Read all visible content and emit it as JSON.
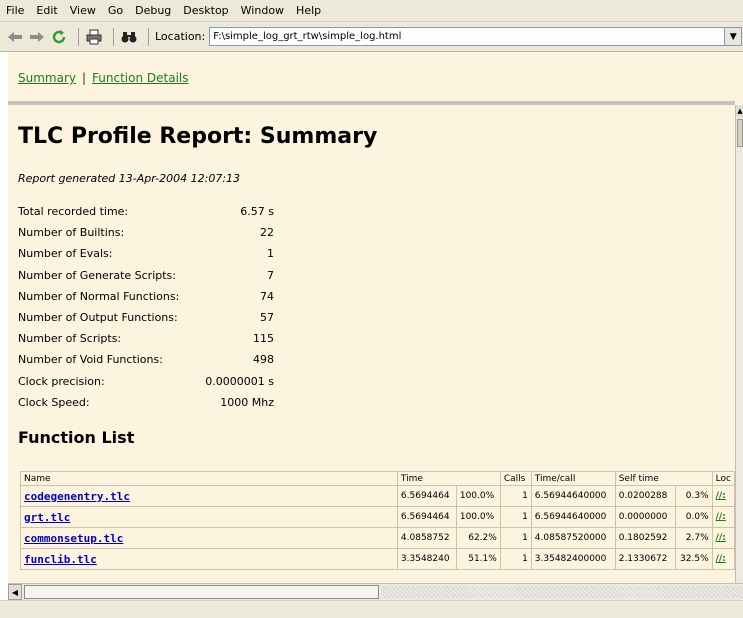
{
  "menu": [
    "File",
    "Edit",
    "View",
    "Go",
    "Debug",
    "Desktop",
    "Window",
    "Help"
  ],
  "toolbar": {
    "location_label": "Location:",
    "location_value": "F:\\simple_log_grt_rtw\\simple_log.html"
  },
  "nav": {
    "summary": "Summary",
    "separator": "|",
    "function_details": "Function Details"
  },
  "report": {
    "title": "TLC Profile Report: Summary",
    "generated": "Report generated 13-Apr-2004 12:07:13"
  },
  "stats": [
    {
      "label": "Total recorded time:",
      "value": "6.57 s"
    },
    {
      "label": "Number of Builtins:",
      "value": "22"
    },
    {
      "label": "Number of Evals:",
      "value": "1"
    },
    {
      "label": "Number of Generate Scripts:",
      "value": "7"
    },
    {
      "label": "Number of Normal Functions:",
      "value": "74"
    },
    {
      "label": "Number of Output Functions:",
      "value": "57"
    },
    {
      "label": "Number of Scripts:",
      "value": "115"
    },
    {
      "label": "Number of Void Functions:",
      "value": "498"
    },
    {
      "label": "Clock precision:",
      "value": "0.0000001 s"
    },
    {
      "label": "Clock Speed:",
      "value": "1000 Mhz"
    }
  ],
  "function_list": {
    "title": "Function List",
    "headers": {
      "name": "Name",
      "time": "Time",
      "calls": "Calls",
      "time_per_call": "Time/call",
      "self_time": "Self time",
      "location": "Loc"
    },
    "rows": [
      {
        "name": "codegenentry.tlc",
        "time": "6.5694464",
        "time_pct": "100.0%",
        "calls": "1",
        "time_call": "6.56944640000",
        "self_time": "0.0200288",
        "self_pct": "0.3%",
        "loc": "//:"
      },
      {
        "name": "grt.tlc",
        "time": "6.5694464",
        "time_pct": "100.0%",
        "calls": "1",
        "time_call": "6.56944640000",
        "self_time": "0.0000000",
        "self_pct": "0.0%",
        "loc": "//:"
      },
      {
        "name": "commonsetup.tlc",
        "time": "4.0858752",
        "time_pct": "62.2%",
        "calls": "1",
        "time_call": "4.08587520000",
        "self_time": "0.1802592",
        "self_pct": "2.7%",
        "loc": "//:"
      },
      {
        "name": "funclib.tlc",
        "time": "3.3548240",
        "time_pct": "51.1%",
        "calls": "1",
        "time_call": "3.35482400000",
        "self_time": "2.1330672",
        "self_pct": "32.5%",
        "loc": "//:"
      }
    ]
  }
}
